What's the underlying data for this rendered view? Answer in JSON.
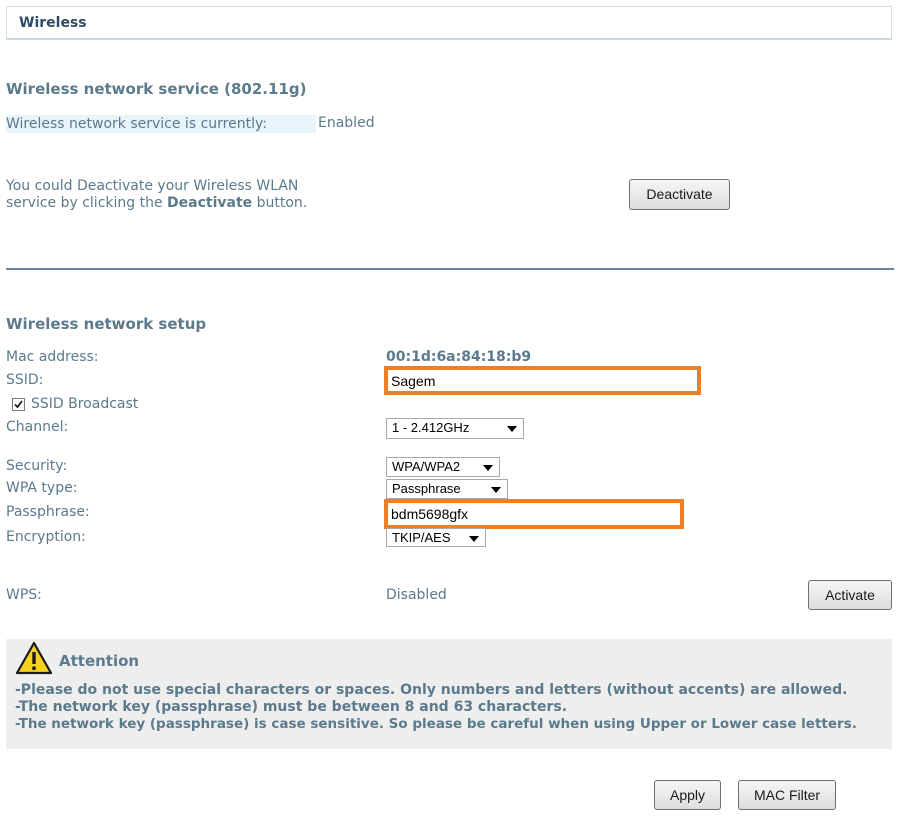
{
  "header": {
    "title": "Wireless"
  },
  "service": {
    "heading": "Wireless network service (802.11g)",
    "status_label": "Wireless network service is currently:",
    "status_value": "Enabled",
    "desc_line1": "You could Deactivate your Wireless WLAN",
    "desc_line2_prefix": "service by clicking the ",
    "desc_line2_bold": "Deactivate",
    "desc_line2_suffix": " button.",
    "deactivate_label": "Deactivate"
  },
  "setup": {
    "heading": "Wireless network setup",
    "mac_label": "Mac address:",
    "mac_value": "00:1d:6a:84:18:b9",
    "ssid_label": "SSID:",
    "ssid_value": "Sagem",
    "ssid_broadcast_label": "SSID Broadcast",
    "ssid_broadcast_checked": true,
    "channel_label": "Channel:",
    "channel_value": "1 - 2.412GHz",
    "security_label": "Security:",
    "security_value": "WPA/WPA2",
    "wpa_type_label": "WPA type:",
    "wpa_type_value": "Passphrase",
    "passphrase_label": "Passphrase:",
    "passphrase_value": "bdm5698gfx",
    "encryption_label": "Encryption:",
    "encryption_value": "TKIP/AES",
    "wps_label": "WPS:",
    "wps_value": "Disabled",
    "activate_label": "Activate"
  },
  "attention": {
    "title": "Attention",
    "lines": [
      "-Please do not use special characters or spaces. Only numbers and letters (without accents) are allowed.",
      "-The network key (passphrase) must be between 8 and 63 characters.",
      "-The network key (passphrase) is case sensitive. So please be careful when using Upper or Lower case letters."
    ]
  },
  "footer": {
    "apply_label": "Apply",
    "mac_filter_label": "MAC Filter"
  },
  "colors": {
    "highlight": "#ef7f25",
    "text": "#5b7a8c",
    "panel": "#eeeeee"
  }
}
